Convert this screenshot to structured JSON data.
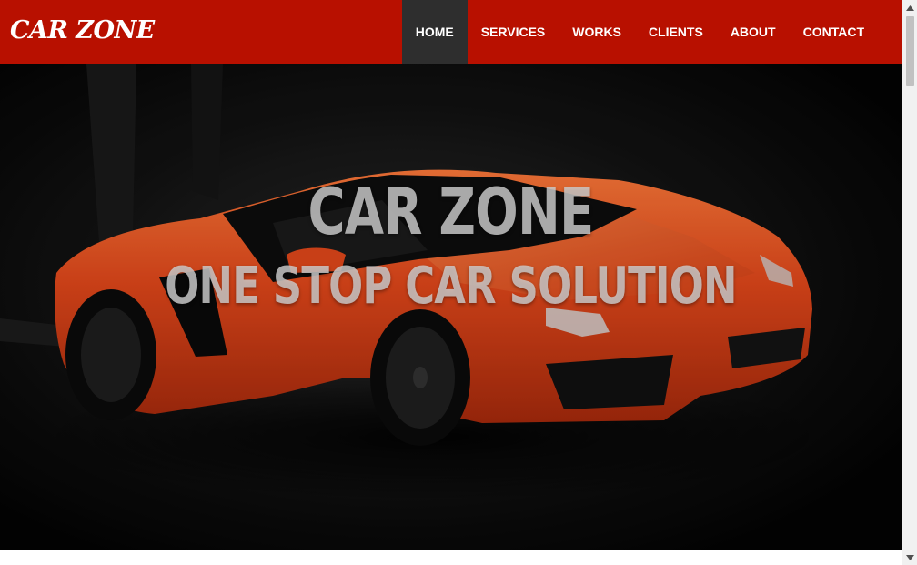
{
  "header": {
    "brand": "CAR ZONE",
    "nav": [
      {
        "label": "HOME",
        "active": true
      },
      {
        "label": "SERVICES",
        "active": false
      },
      {
        "label": "WORKS",
        "active": false
      },
      {
        "label": "CLIENTS",
        "active": false
      },
      {
        "label": "ABOUT",
        "active": false
      },
      {
        "label": "CONTACT",
        "active": false
      }
    ]
  },
  "hero": {
    "title": "CAR ZONE",
    "subtitle": "ONE STOP CAR SOLUTION",
    "image_icon": "orange-sports-car"
  },
  "colors": {
    "navbar": "#b81000",
    "nav_active": "#2e2e2e",
    "hero_background": "#060606",
    "car_body": "#e0461c"
  },
  "scrollbar": {
    "up_icon": "arrow-up-icon",
    "down_icon": "arrow-down-icon"
  }
}
